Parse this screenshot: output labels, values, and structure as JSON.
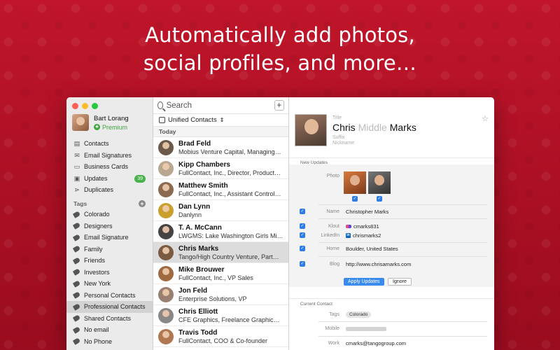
{
  "headline": {
    "line1": "Automatically add photos,",
    "line2": "social profiles, and more…"
  },
  "colors": {
    "background": "#b31227",
    "accent": "#3a8bf0",
    "premium": "#3fa53f"
  },
  "account": {
    "name": "Bart Lorang",
    "plan": "Premium"
  },
  "nav": [
    {
      "label": "Contacts",
      "icon": "contacts-icon"
    },
    {
      "label": "Email Signatures",
      "icon": "envelope-icon"
    },
    {
      "label": "Business Cards",
      "icon": "card-icon"
    },
    {
      "label": "Updates",
      "icon": "updates-icon",
      "badge": "39"
    },
    {
      "label": "Duplicates",
      "icon": "merge-icon"
    }
  ],
  "tags_header": "Tags",
  "tags": [
    "Colorado",
    "Designers",
    "Email Signature",
    "Family",
    "Friends",
    "Investors",
    "New York",
    "Personal Contacts",
    "Professional Contacts",
    "Shared Contacts",
    "No email",
    "No Phone"
  ],
  "list": {
    "search_placeholder": "Search",
    "add_label": "+",
    "source": "Unified Contacts",
    "section": "Today",
    "rows": [
      {
        "name": "Brad Feld",
        "sub": "Mobius Venture Capital, Managing…"
      },
      {
        "name": "Kipp Chambers",
        "sub": "FullContact, Inc., Director, Product…"
      },
      {
        "name": "Matthew Smith",
        "sub": "FullContact, Inc., Assistant Control…"
      },
      {
        "name": "Dan Lynn",
        "sub": "Danlynn"
      },
      {
        "name": "T. A. McCann",
        "sub": "LWGMS: Lake Washington Girls Mi…"
      },
      {
        "name": "Chris Marks",
        "sub": "Tango/High Country Venture, Part…"
      },
      {
        "name": "Mike Brouwer",
        "sub": "FullContact, Inc., VP Sales"
      },
      {
        "name": "Jon Feld",
        "sub": "Enterprise Solutions, VP"
      },
      {
        "name": "Chris Elliott",
        "sub": "CFE Graphics, Freelance Graphic…"
      },
      {
        "name": "Travis Todd",
        "sub": "FullContact, COO & Co-founder"
      }
    ]
  },
  "detail": {
    "title_placeholder": "Title",
    "first": "Chris",
    "middle": "Middle",
    "last": "Marks",
    "suffix_placeholder": "Suffix",
    "nickname_placeholder": "Nickname",
    "new_updates_label": "New Updates",
    "photo_label": "Photo",
    "fields": [
      {
        "label": "Name",
        "value": "Christopher Marks"
      },
      {
        "label": "Klout",
        "value": "cmarks831"
      },
      {
        "label": "LinkedIn",
        "value": "chrismarks2"
      },
      {
        "label": "Home",
        "value": "Boulder, United States"
      },
      {
        "label": "Blog",
        "value": "http://www.chrisamarks.com"
      }
    ],
    "apply_label": "Apply Updates",
    "ignore_label": "Ignore",
    "current_label": "Current Contact",
    "tags_label": "Tags",
    "tag_value": "Colorado",
    "mobile_label": "Mobile",
    "work_label": "Work",
    "work_value": "cmarks@tangogroup.com"
  }
}
